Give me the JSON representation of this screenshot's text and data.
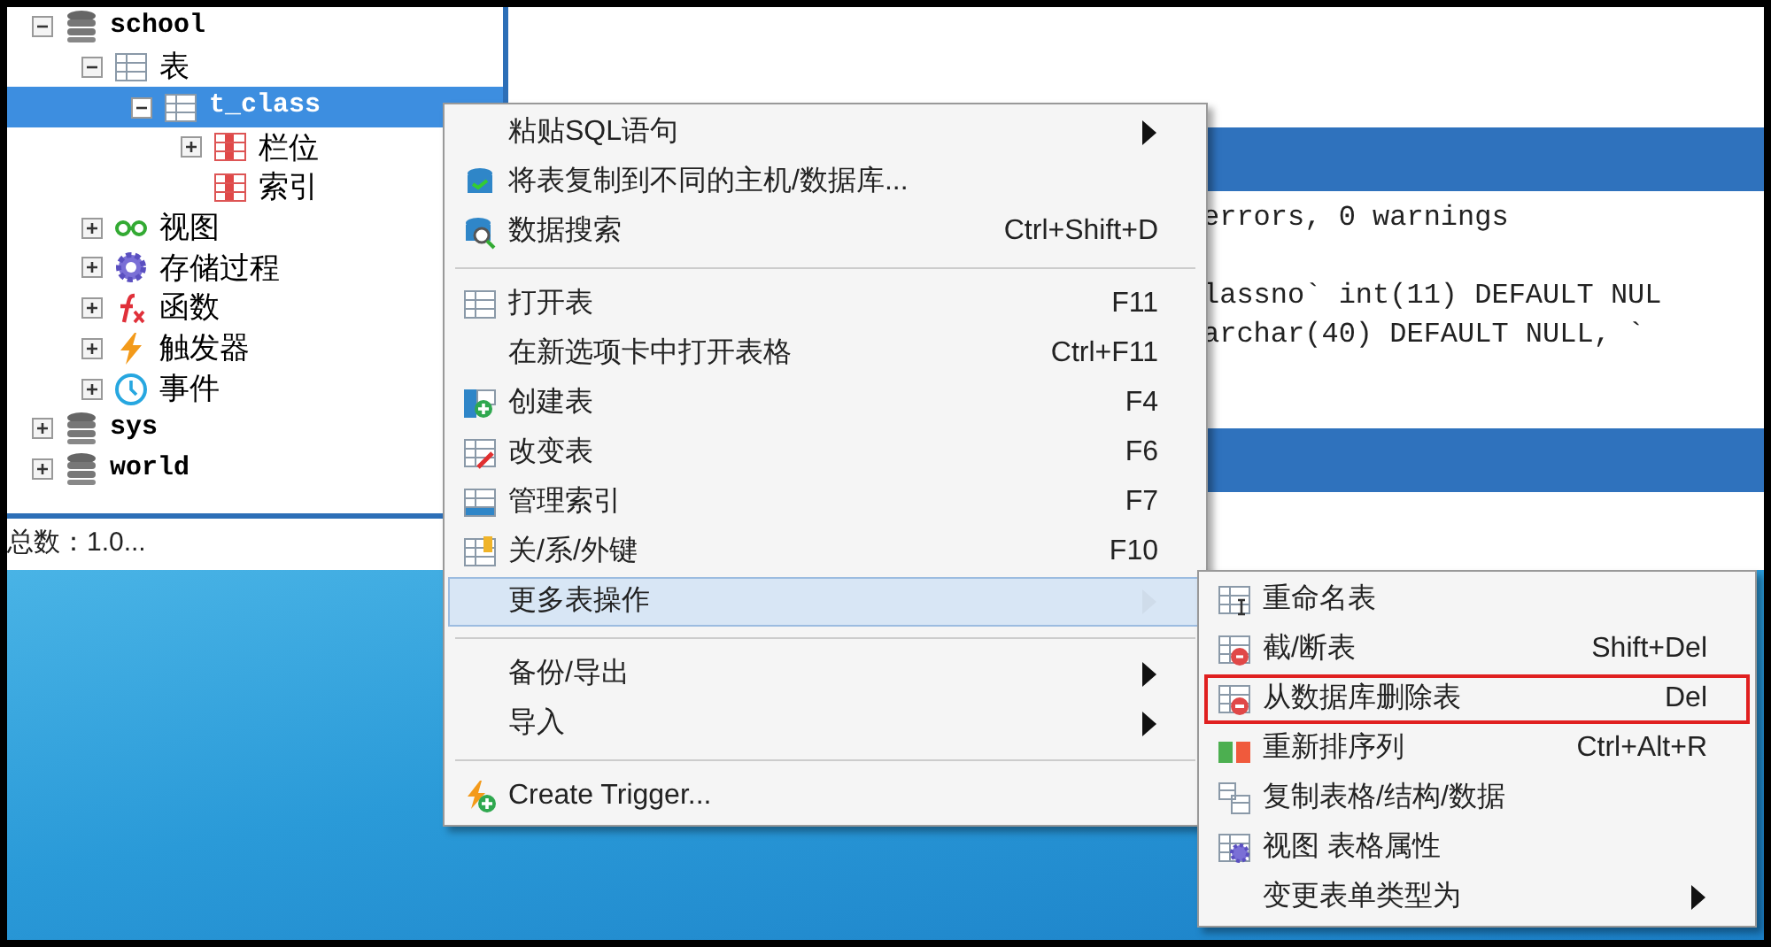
{
  "tree": [
    {
      "label": "school",
      "kind": "database",
      "expanded": true,
      "selected": false,
      "children": [
        {
          "label": "表",
          "kind": "tables",
          "expanded": true,
          "selected": false,
          "children": [
            {
              "label": "t_class",
              "kind": "tables",
              "expanded": true,
              "selected": true,
              "children": [
                {
                  "label": "栏位",
                  "kind": "columns",
                  "expanded": false,
                  "selected": false
                },
                {
                  "label": "索引",
                  "kind": "columns",
                  "selected": false
                }
              ]
            }
          ]
        },
        {
          "label": "视图",
          "kind": "view",
          "expanded": false,
          "selected": false
        },
        {
          "label": "存储过程",
          "kind": "gear",
          "expanded": false,
          "selected": false
        },
        {
          "label": "函数",
          "kind": "function",
          "expanded": false,
          "selected": false
        },
        {
          "label": "触发器",
          "kind": "lightning",
          "expanded": false,
          "selected": false
        },
        {
          "label": "事件",
          "kind": "clock",
          "expanded": false,
          "selected": false
        }
      ]
    },
    {
      "label": "sys",
      "kind": "database",
      "expanded": false,
      "selected": false
    },
    {
      "label": "world",
      "kind": "database",
      "expanded": false,
      "selected": false
    }
  ],
  "status_bar": "总数：1.0...",
  "output_blocks": [
    [
      "errors, 0 warnings"
    ],
    [
      "lassno` int(11) DEFAULT NUL",
      "archar(40) DEFAULT NULL, `"
    ]
  ],
  "context_menu": [
    {
      "kind": "plain",
      "label": "粘贴SQL语句",
      "submenu": true,
      "selected": false
    },
    {
      "kind": "copy-db",
      "label": "将表复制到不同的主机/数据库...",
      "submenu": false,
      "selected": false
    },
    {
      "kind": "search-db",
      "label": "数据搜索",
      "shortcut": "Ctrl+Shift+D",
      "submenu": false,
      "selected": false
    },
    {
      "kind": "separator"
    },
    {
      "kind": "grid",
      "label": "打开表",
      "shortcut": "F11",
      "submenu": false,
      "selected": false
    },
    {
      "kind": "plain",
      "label": "在新选项卡中打开表格",
      "shortcut": "Ctrl+F11",
      "submenu": false,
      "selected": false
    },
    {
      "kind": "create",
      "label": "创建表",
      "shortcut": "F4",
      "submenu": false,
      "selected": false
    },
    {
      "kind": "alter",
      "label": "改变表",
      "shortcut": "F6",
      "submenu": false,
      "selected": false
    },
    {
      "kind": "index",
      "label": "管理索引",
      "shortcut": "F7",
      "submenu": false,
      "selected": false
    },
    {
      "kind": "relation",
      "label": "关/系/外键",
      "shortcut": "F10",
      "submenu": false,
      "selected": false
    },
    {
      "kind": "plain",
      "label": "更多表操作",
      "submenu": true,
      "selected": true
    },
    {
      "kind": "separator"
    },
    {
      "kind": "plain",
      "label": "备份/导出",
      "submenu": true,
      "selected": false
    },
    {
      "kind": "plain",
      "label": "导入",
      "submenu": true,
      "selected": false
    },
    {
      "kind": "separator"
    },
    {
      "kind": "trigger",
      "label": "Create Trigger...",
      "submenu": false,
      "selected": false
    }
  ],
  "submenu": [
    {
      "kind": "rename",
      "label": "重命名表",
      "submenu": false,
      "outlined": false
    },
    {
      "kind": "truncate",
      "label": "截/断表",
      "shortcut": "Shift+Del",
      "submenu": false,
      "outlined": false
    },
    {
      "kind": "delete",
      "label": "从数据库删除表",
      "shortcut": "Del",
      "submenu": false,
      "outlined": true
    },
    {
      "kind": "reorder",
      "label": "重新排序列",
      "shortcut": "Ctrl+Alt+R",
      "submenu": false,
      "outlined": false
    },
    {
      "kind": "copy-table",
      "label": "复制表格/结构/数据",
      "submenu": false,
      "outlined": false
    },
    {
      "kind": "view-props",
      "label": "视图 表格属性",
      "submenu": false,
      "outlined": false
    },
    {
      "kind": "plain",
      "label": "变更表单类型为",
      "submenu": true,
      "outlined": false
    }
  ]
}
